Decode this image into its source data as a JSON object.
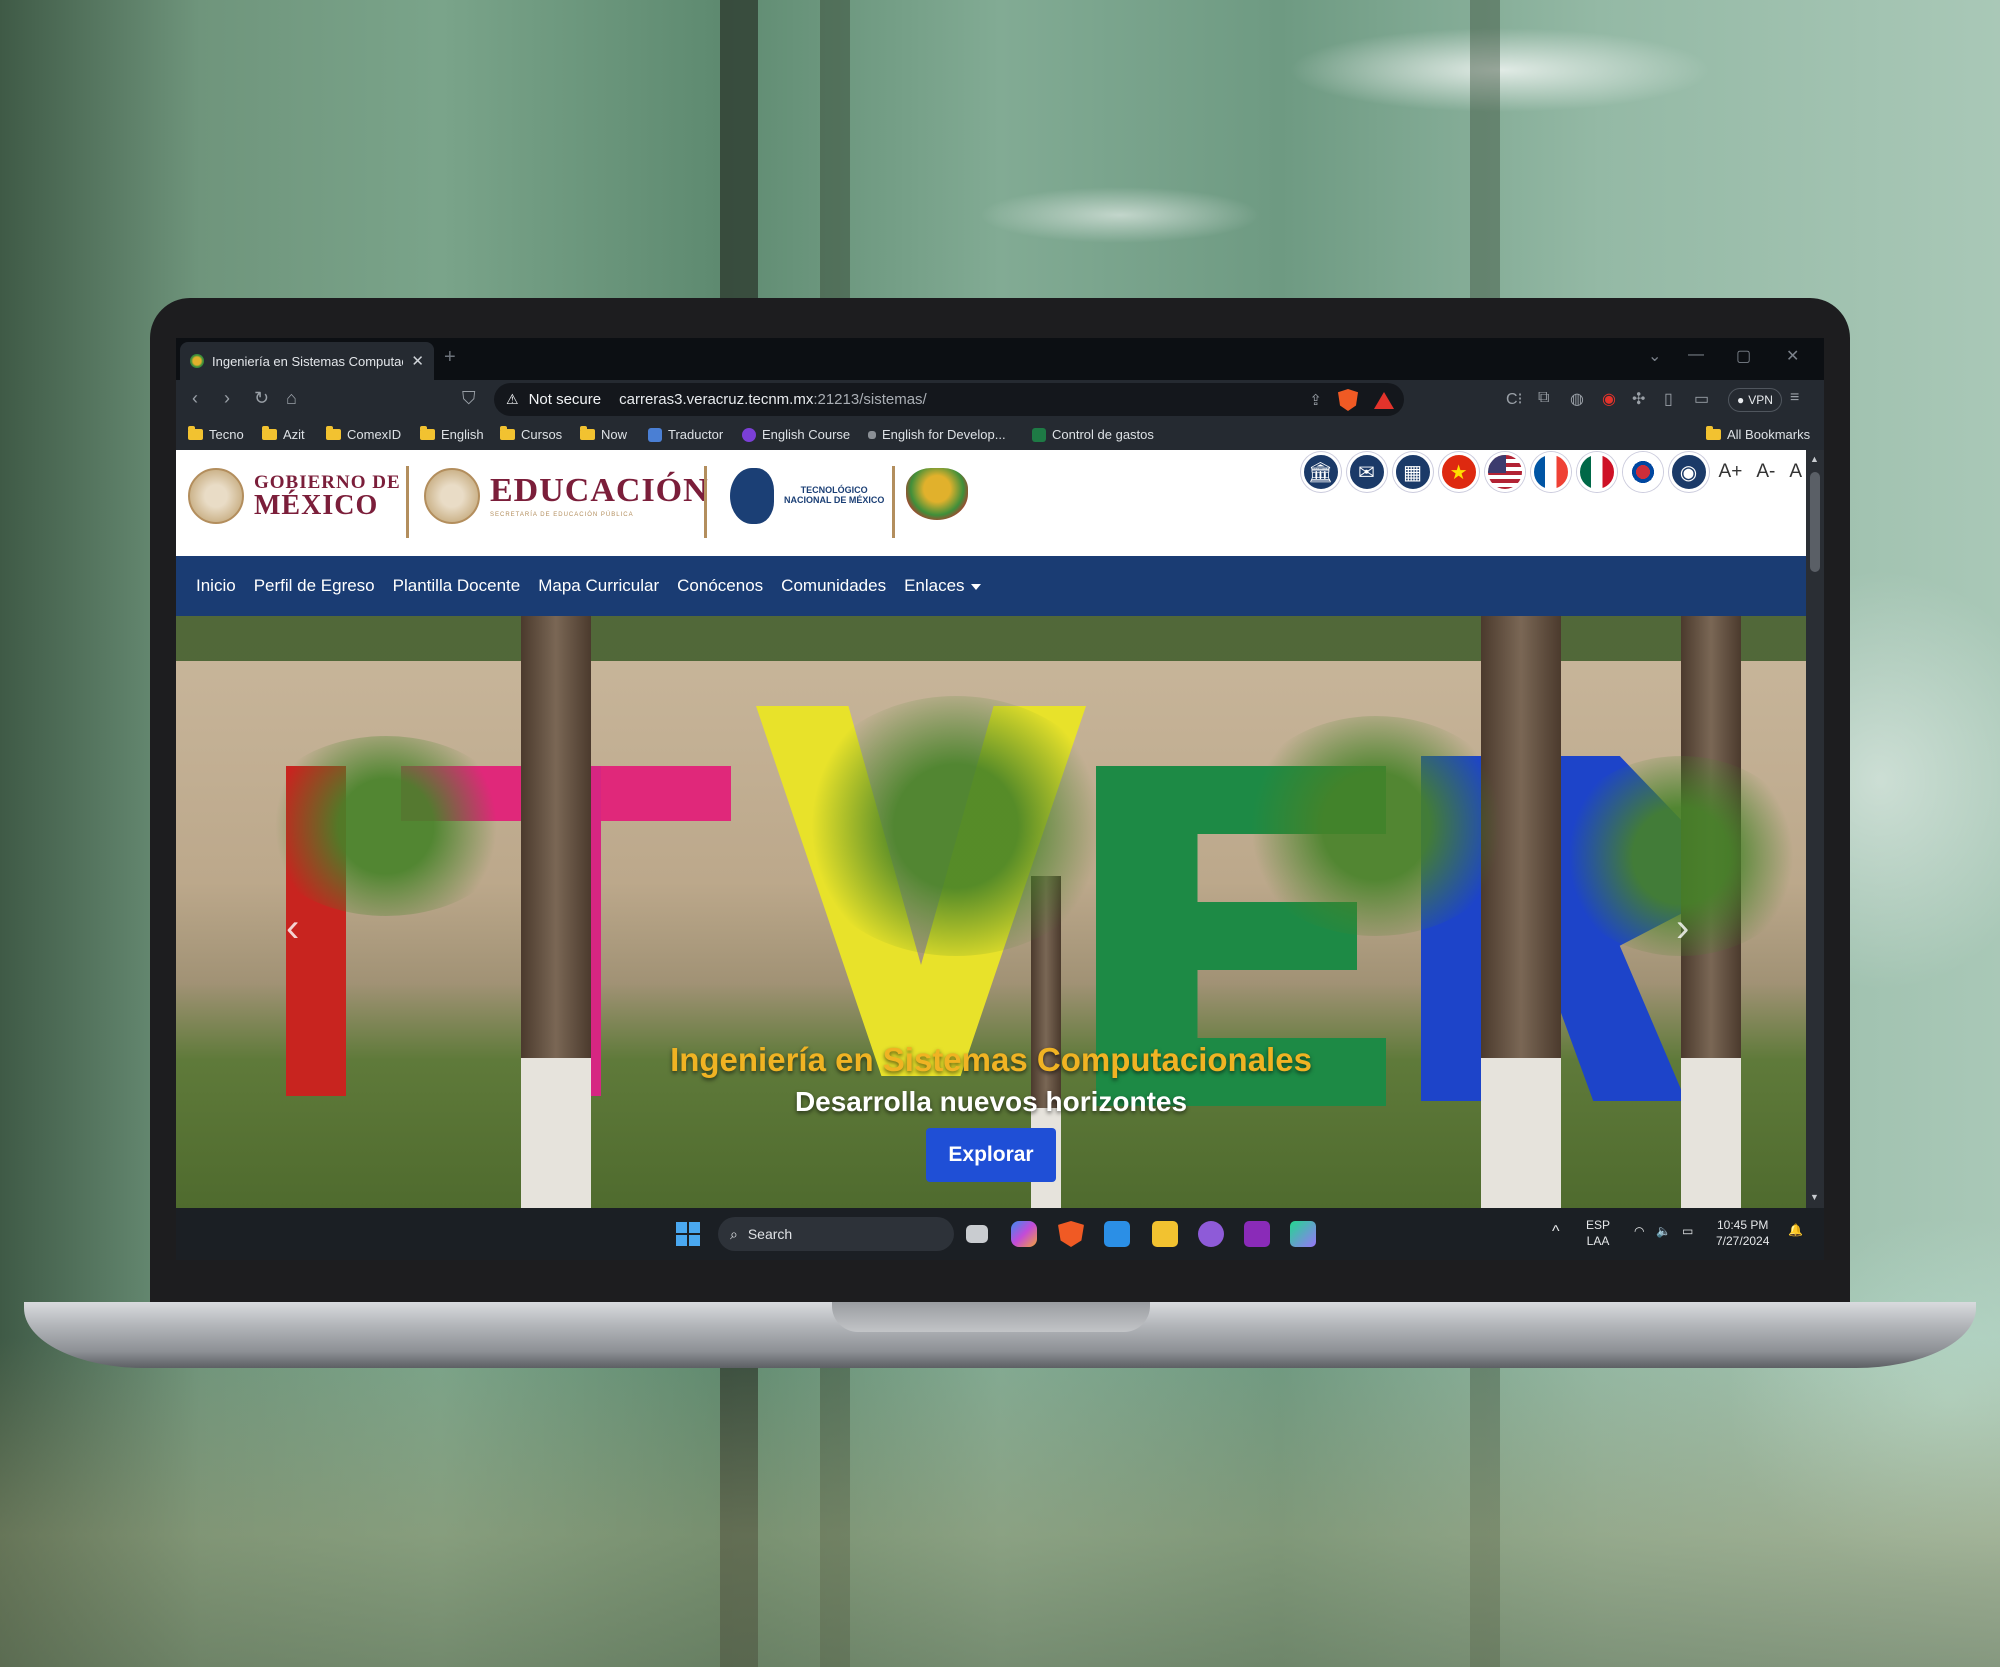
{
  "browser": {
    "tab_title": "Ingeniería en Sistemas Computacionales",
    "security_label": "Not secure",
    "url_host": "carreras3.veracruz.tecnm.mx",
    "url_path": ":21213/sistemas/",
    "vpn_label": "VPN",
    "bookmarks": [
      {
        "label": "Tecno",
        "icon": "folder-icon"
      },
      {
        "label": "Azit",
        "icon": "folder-icon"
      },
      {
        "label": "ComexID",
        "icon": "folder-icon"
      },
      {
        "label": "English",
        "icon": "folder-icon"
      },
      {
        "label": "Cursos",
        "icon": "folder-icon"
      },
      {
        "label": "Now",
        "icon": "folder-icon"
      },
      {
        "label": "Traductor",
        "icon": "translate-icon"
      },
      {
        "label": "English Course",
        "icon": "course-icon"
      },
      {
        "label": "English for Develop...",
        "icon": "doc-icon"
      },
      {
        "label": "Control de gastos",
        "icon": "excel-icon"
      }
    ],
    "all_bookmarks": "All Bookmarks"
  },
  "header": {
    "gob_line1": "GOBIERNO DE",
    "gob_line2": "MÉXICO",
    "edu_title": "EDUCACIÓN",
    "edu_sub": "SECRETARÍA DE EDUCACIÓN PÚBLICA",
    "tec_line1": "TECNOLÓGICO",
    "tec_line2": "NACIONAL DE MÉXICO",
    "font_plus": "A+",
    "font_minus": "A-",
    "font_reset": "A"
  },
  "nav": {
    "items": [
      "Inicio",
      "Perfil de Egreso",
      "Plantilla Docente",
      "Mapa Curricular",
      "Conócenos",
      "Comunidades",
      "Enlaces"
    ]
  },
  "hero": {
    "title": "Ingeniería en Sistemas Computacionales",
    "subtitle": "Desarrolla nuevos horizontes",
    "button": "Explorar"
  },
  "taskbar": {
    "search_label": "Search",
    "lang_line1": "ESP",
    "lang_line2": "LAA",
    "time": "10:45 PM",
    "date": "7/27/2024"
  },
  "colors": {
    "nav_bg": "#1a3c73",
    "brand_maroon": "#7b1e3a",
    "hero_title": "#f0b323",
    "button": "#1f4fd6"
  }
}
